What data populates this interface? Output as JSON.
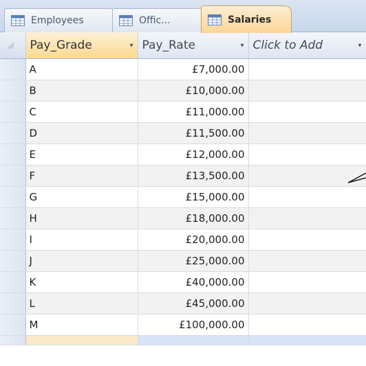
{
  "tabs": [
    {
      "label": "Employees",
      "active": false
    },
    {
      "label": "Offic...",
      "active": false
    },
    {
      "label": "Salaries",
      "active": true
    }
  ],
  "table": {
    "columns": [
      {
        "label": "Pay_Grade",
        "arrow": "▾"
      },
      {
        "label": "Pay_Rate",
        "arrow": "▾"
      },
      {
        "label": "Click to Add",
        "arrow": "▾"
      }
    ],
    "rows": [
      {
        "grade": "A",
        "rate": "£7,000.00"
      },
      {
        "grade": "B",
        "rate": "£10,000.00"
      },
      {
        "grade": "C",
        "rate": "£11,000.00"
      },
      {
        "grade": "D",
        "rate": "£11,500.00"
      },
      {
        "grade": "E",
        "rate": "£12,000.00"
      },
      {
        "grade": "F",
        "rate": "£13,500.00"
      },
      {
        "grade": "G",
        "rate": "£15,000.00"
      },
      {
        "grade": "H",
        "rate": "£18,000.00"
      },
      {
        "grade": "I",
        "rate": "£20,000.00"
      },
      {
        "grade": "J",
        "rate": "£25,000.00"
      },
      {
        "grade": "K",
        "rate": "£40,000.00"
      },
      {
        "grade": "L",
        "rate": "£45,000.00"
      },
      {
        "grade": "M",
        "rate": "£100,000.00"
      }
    ]
  },
  "colors": {
    "active_tab": "#fbd597",
    "tab_strip": "#c8d7ec",
    "alt_row": "#f2f2f2"
  },
  "icons": {
    "tab_icon": "table-icon",
    "column_menu": "dropdown-arrow-icon"
  }
}
